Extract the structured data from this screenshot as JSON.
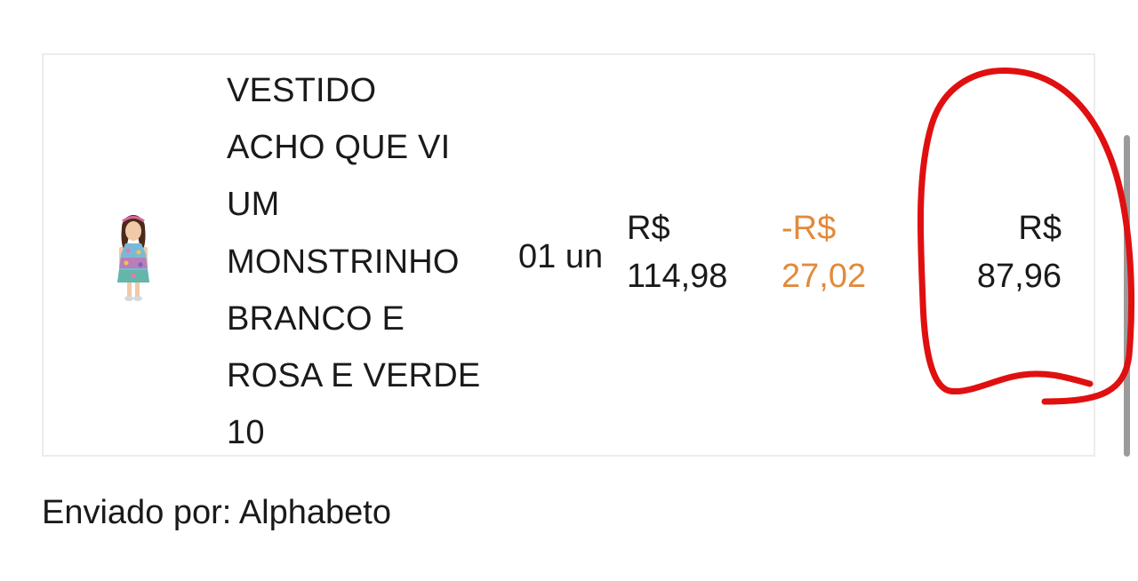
{
  "order_item": {
    "product_name_lines": [
      "VESTIDO",
      "ACHO QUE VI",
      "UM",
      "MONSTRINHO",
      "BRANCO E",
      "ROSA E VERDE",
      "10"
    ],
    "quantity": "01 un",
    "unit_price": {
      "currency": "R$",
      "amount": "114,98"
    },
    "discount": {
      "currency": "-R$",
      "amount": "27,02"
    },
    "total": {
      "currency": "R$",
      "amount": "87,96"
    }
  },
  "sender": "Enviado por: Alphabeto",
  "colors": {
    "discount": "#e28a3c",
    "annotation": "#e01010",
    "border": "#ececec"
  }
}
